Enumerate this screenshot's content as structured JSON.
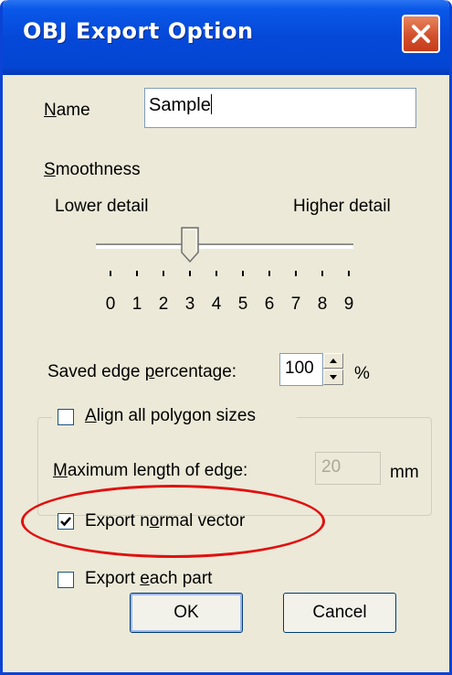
{
  "window": {
    "title": "OBJ Export Option"
  },
  "name": {
    "label_pre": "",
    "label_u": "N",
    "label_post": "ame",
    "value": "Sample"
  },
  "smoothness": {
    "label_pre": "",
    "label_u": "S",
    "label_post": "moothness",
    "lower_label": "Lower detail",
    "higher_label": "Higher detail",
    "ticks": [
      "0",
      "1",
      "2",
      "3",
      "4",
      "5",
      "6",
      "7",
      "8",
      "9"
    ],
    "value": 3,
    "min": 0,
    "max": 9
  },
  "saved_edge": {
    "label_pre": "Saved edge ",
    "label_u": "p",
    "label_post": "ercentage:",
    "value": "100",
    "unit": "%"
  },
  "align": {
    "checkbox_label_pre": "",
    "checkbox_label_u": "A",
    "checkbox_label_post": "lign all polygon sizes",
    "checked": false,
    "max_len_label_pre": "",
    "max_len_label_u": "M",
    "max_len_label_post": "aximum length of edge:",
    "max_len_value": "20",
    "unit": "mm"
  },
  "export_normal": {
    "label_pre": "Export n",
    "label_u": "o",
    "label_post": "rmal vector",
    "checked": true
  },
  "export_each": {
    "label_pre": "Export ",
    "label_u": "e",
    "label_post": "ach part",
    "checked": false
  },
  "buttons": {
    "ok": "OK",
    "cancel": "Cancel"
  },
  "colors": {
    "titlebar": "#0548d8",
    "dialog_bg": "#ece9d8",
    "highlight_ring": "#e01010"
  }
}
